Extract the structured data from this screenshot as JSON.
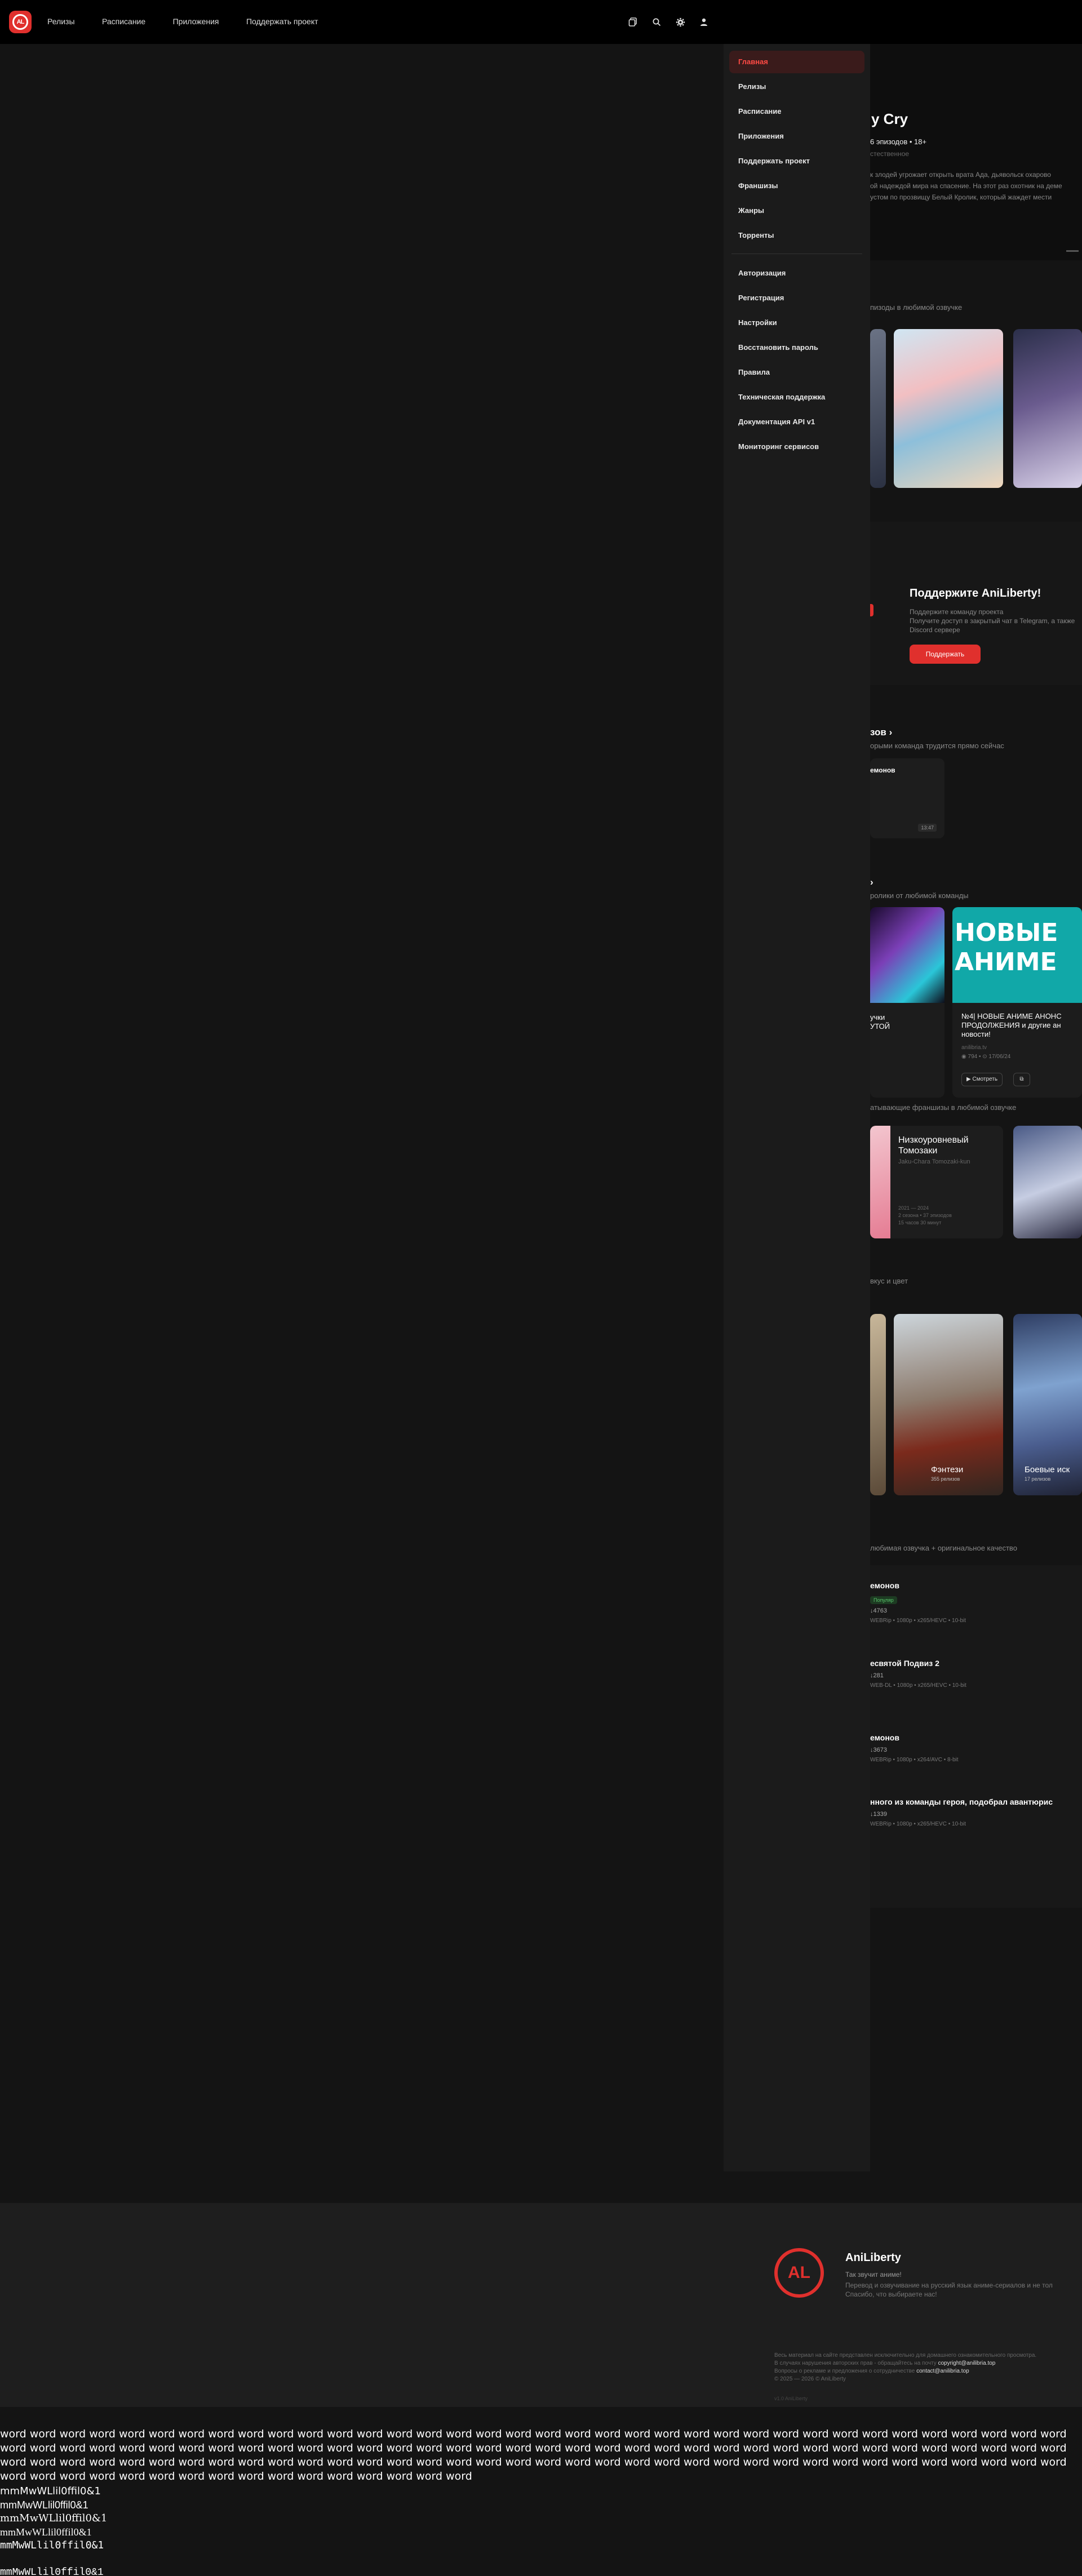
{
  "header": {
    "logo_text": "AL",
    "nav": [
      "Релизы",
      "Расписание",
      "Приложения",
      "Поддержать проект"
    ],
    "icons": [
      "library-icon",
      "search-icon",
      "gear-icon",
      "user-icon"
    ]
  },
  "menu": {
    "primary": [
      "Главная",
      "Релизы",
      "Расписание",
      "Приложения",
      "Поддержать проект",
      "Франшизы",
      "Жанры",
      "Торренты"
    ],
    "secondary": [
      "Авторизация",
      "Регистрация",
      "Настройки",
      "Восстановить пароль",
      "Правила",
      "Техническая поддержка",
      "Документация API v1",
      "Мониторинг сервисов"
    ]
  },
  "hero": {
    "title": "y Cry",
    "meta": "6 эпизодов  •  18+",
    "sub": "стественное",
    "desc": [
      "к злодей угрожает открыть врата Ада, дьявольск охарово",
      "ой надеждой мира на спасение. На этот раз охотник на деме",
      "устом по прозвищу Белый Кролик, который жаждет мести"
    ]
  },
  "sections": {
    "episodes_sub": "пизоды в любимой озвучке",
    "support_title": "Поддержите AniLiberty!",
    "support_text": [
      "Поддержите команду проекта",
      "Получите доступ в закрытый чат в Telegram, а также",
      "Discord сервере"
    ],
    "support_button": "Поддержать",
    "progress_title": "зов ›",
    "progress_sub": "орыми команда трудится прямо сейчас",
    "progress_card_title": "емонов",
    "progress_card_time": "13:47",
    "videos_title": "›",
    "videos_sub": "ролики от любимой команды",
    "video1_title": [
      "учки",
      "УТОЙ"
    ],
    "video2_title": [
      "№4| НОВЫЕ АНИМЕ АНОНС",
      "ПРОДОЛЖЕНИЯ и другие ан",
      "новости!"
    ],
    "video2_banner": [
      "НОВЫЕ",
      "АНИМЕ"
    ],
    "video2_source": "anilibria.tv",
    "video2_stats": "◉ 794  •  ⊙ 17/06/24",
    "watch_button": "▶ Смотреть",
    "franchise_sub": "атывающие франшизы в любимой озвучке",
    "franchise_title": [
      "Низкоуровневый",
      "Томозаки"
    ],
    "franchise_alt": "Jaku-Chara Tomozaki-kun",
    "franchise_meta": [
      "2021 — 2024",
      "2 сезона • 37 эпизодов",
      "15 часов 30 минут"
    ],
    "genres_sub": "вкус и цвет",
    "genre1": "Фэнтези",
    "genre1_count": "355 релизов",
    "genre2": "Боевые иск",
    "genre2_count": "17 релизов",
    "torrents_sub": "любимая озвучка + оригинальное качество"
  },
  "torrents": [
    {
      "title": "емонов",
      "badge": "Популяр",
      "count": "↓4763",
      "meta": "WEBRip • 1080p • x265/HEVC • 10-bit"
    },
    {
      "title": "есвятой Подвиз 2",
      "badge": "",
      "count": "↓281",
      "meta": "WEB-DL • 1080p • x265/HEVC • 10-bit"
    },
    {
      "title": "емонов",
      "badge": "",
      "count": "↓3673",
      "meta": "WEBRip • 1080p • x264/AVC • 8-bit"
    },
    {
      "title": "нного из команды героя, подобрал авантюрис",
      "badge": "",
      "count": "↓1339",
      "meta": "WEBRip • 1080p • x265/HEVC • 10-bit"
    }
  ],
  "footer": {
    "brand": "AniLiberty",
    "tagline": "Так звучит аниме!",
    "desc": [
      "Перевод и озвучивание на русский язык аниме-сериалов и не тол",
      "Спасибо, что выбираете нас!"
    ],
    "legal1": "Весь материал на сайте представлен исключительно для домашнего ознакомительного просмотра.",
    "legal2_pre": "В случаях нарушения авторских прав - обращайтесь на почту",
    "legal2_email": "copyright@anilibria.top",
    "legal3_pre": "Вопросы о рекламе и предложения о сотрудничестве",
    "legal3_email": "contact@anilibria.top",
    "copyright": "© 2025 — 2026 © AniLiberty",
    "small": "v1.0 AniLiberty"
  },
  "font_test": {
    "words": "word word word word word word word word word word word word word word word word word word word word word word word word word word word word word word word word word word word word word word word word word word word word word word word word word word word word word word word word word word word word word word word word word word word word word word word word word word word word word word word word word word word word word word word word word word word word word word word word word word word word word word word word word word word word word word word word word word word word word word word word word word word word",
    "glyphs": "mmMwWLlil0ffil0&1"
  }
}
